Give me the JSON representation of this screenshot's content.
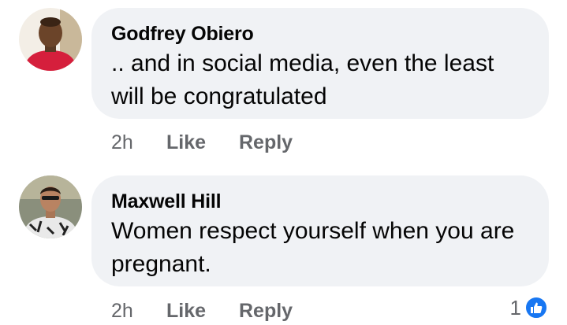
{
  "comments": [
    {
      "author": "Godfrey Obiero",
      "text": ".. and in social media, even the least will be congratulated",
      "time": "2h",
      "like_label": "Like",
      "reply_label": "Reply"
    },
    {
      "author": "Maxwell Hill",
      "text": "Women respect yourself when you are pregnant.",
      "time": "2h",
      "like_label": "Like",
      "reply_label": "Reply",
      "reaction_count": "1"
    }
  ],
  "colors": {
    "bubble": "#f0f2f5",
    "meta_text": "#65676b",
    "like_blue": "#1877f2"
  },
  "icons": {
    "reaction": "thumbs-up-icon"
  }
}
